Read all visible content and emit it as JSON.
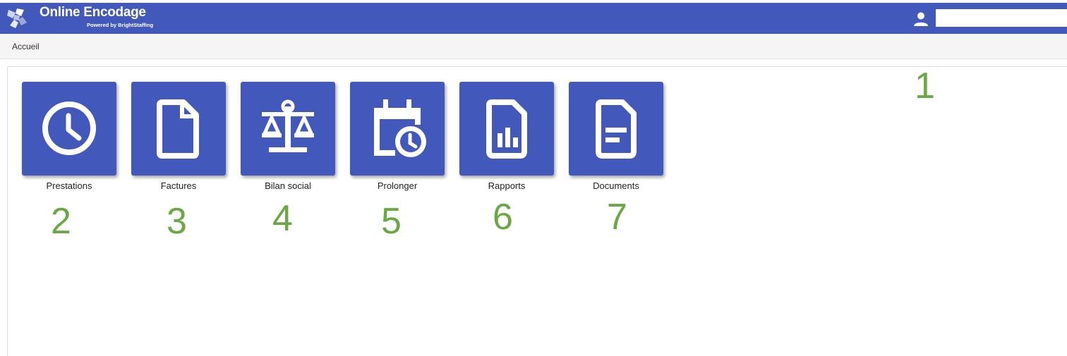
{
  "header": {
    "app_title": "Online Encodage",
    "powered_by": "Powered by BrightStaffing",
    "logo_icon": "brightstaffing-logo-icon",
    "user_icon": "user-icon",
    "user_field_value": ""
  },
  "breadcrumb": {
    "label": "Accueil"
  },
  "colors": {
    "primary": "#4358bb",
    "callout": "#6aa843",
    "breadcrumb_bg": "#f5f5f5"
  },
  "tiles": [
    {
      "label": "Prestations",
      "icon": "clock-icon"
    },
    {
      "label": "Factures",
      "icon": "document-icon"
    },
    {
      "label": "Bilan social",
      "icon": "balance-scale-icon"
    },
    {
      "label": "Prolonger",
      "icon": "calendar-clock-icon"
    },
    {
      "label": "Rapports",
      "icon": "report-chart-icon"
    },
    {
      "label": "Documents",
      "icon": "text-document-icon"
    }
  ],
  "callouts": [
    "1",
    "2",
    "3",
    "4",
    "5",
    "6",
    "7"
  ]
}
